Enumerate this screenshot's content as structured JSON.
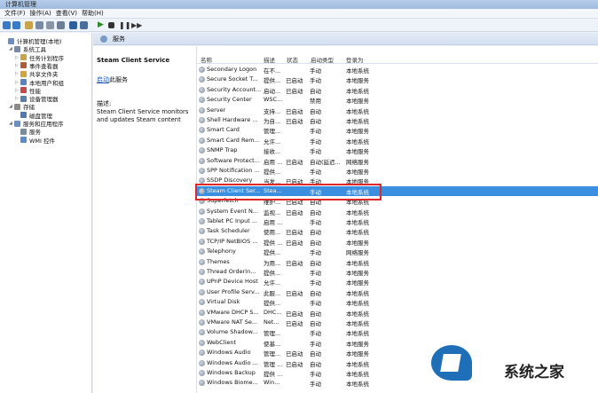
{
  "window": {
    "title": "计算机管理"
  },
  "menu": [
    "文件(F)",
    "操作(A)",
    "查看(V)",
    "帮助(H)"
  ],
  "tree": [
    {
      "label": "计算机管理(本地)",
      "level": 0
    },
    {
      "label": "系统工具",
      "level": 1
    },
    {
      "label": "任务计划程序",
      "level": 2
    },
    {
      "label": "事件查看器",
      "level": 2
    },
    {
      "label": "共享文件夹",
      "level": 2
    },
    {
      "label": "本地用户和组",
      "level": 2
    },
    {
      "label": "性能",
      "level": 2
    },
    {
      "label": "设备管理器",
      "level": 2
    },
    {
      "label": "存储",
      "level": 1
    },
    {
      "label": "磁盘管理",
      "level": 2
    },
    {
      "label": "服务和应用程序",
      "level": 1
    },
    {
      "label": "服务",
      "level": 2
    },
    {
      "label": "WMI 控件",
      "level": 2
    }
  ],
  "header": {
    "title": "服务"
  },
  "details": {
    "service_name": "Steam Client Service",
    "start_link": "启动",
    "start_suffix": "此服务",
    "desc_label": "描述:",
    "desc_text": "Steam Client Service monitors and updates Steam content"
  },
  "columns": [
    "名称",
    "描述",
    "状态",
    "启动类型",
    "登录为"
  ],
  "services": [
    [
      "Secondary Logon",
      "在不...",
      "",
      "手动",
      "本地系统"
    ],
    [
      "Secure Socket T...",
      "提供...",
      "已启动",
      "手动",
      "本地服务"
    ],
    [
      "Security Account...",
      "启动...",
      "已启动",
      "自动",
      "本地系统"
    ],
    [
      "Security Center",
      "WSC...",
      "",
      "禁用",
      "本地服务"
    ],
    [
      "Server",
      "支持...",
      "已启动",
      "自动",
      "本地系统"
    ],
    [
      "Shell Hardware ...",
      "为自...",
      "已启动",
      "自动",
      "本地系统"
    ],
    [
      "Smart Card",
      "管理...",
      "",
      "手动",
      "本地服务"
    ],
    [
      "Smart Card Rem...",
      "允许...",
      "",
      "手动",
      "本地系统"
    ],
    [
      "SNMP Trap",
      "接收...",
      "",
      "手动",
      "本地服务"
    ],
    [
      "Software Protect...",
      "启用 ...",
      "已启动",
      "自动(延迟...",
      "网络服务"
    ],
    [
      "SPP Notification ...",
      "提供...",
      "",
      "手动",
      "本地服务"
    ],
    [
      "SSDP Discovery",
      "当发...",
      "已启动",
      "手动",
      "本地服务"
    ],
    [
      "Steam Client Ser...",
      "Stea...",
      "",
      "手动",
      "本地系统"
    ],
    [
      "Superfetch",
      "维护...",
      "已启动",
      "自动",
      "本地系统"
    ],
    [
      "System Event N...",
      "监视...",
      "已启动",
      "自动",
      "本地系统"
    ],
    [
      "Tablet PC Input ...",
      "启用 ...",
      "",
      "手动",
      "本地系统"
    ],
    [
      "Task Scheduler",
      "使用...",
      "已启动",
      "自动",
      "本地系统"
    ],
    [
      "TCP/IP NetBIOS ...",
      "提供 ...",
      "已启动",
      "自动",
      "本地服务"
    ],
    [
      "Telephony",
      "提供...",
      "",
      "手动",
      "网络服务"
    ],
    [
      "Themes",
      "为用...",
      "已启动",
      "自动",
      "本地系统"
    ],
    [
      "Thread Orderin...",
      "提供...",
      "",
      "手动",
      "本地服务"
    ],
    [
      "UPnP Device Host",
      "允许...",
      "",
      "手动",
      "本地服务"
    ],
    [
      "User Profile Serv...",
      "此服...",
      "已启动",
      "自动",
      "本地系统"
    ],
    [
      "Virtual Disk",
      "提供...",
      "",
      "手动",
      "本地系统"
    ],
    [
      "VMware DHCP S...",
      "DHC...",
      "已启动",
      "自动",
      "本地系统"
    ],
    [
      "VMware NAT Se...",
      "Net...",
      "已启动",
      "自动",
      "本地系统"
    ],
    [
      "Volume Shadow...",
      "管理...",
      "",
      "手动",
      "本地系统"
    ],
    [
      "WebClient",
      "使基...",
      "",
      "手动",
      "本地服务"
    ],
    [
      "Windows Audio",
      "管理...",
      "已启动",
      "自动",
      "本地服务"
    ],
    [
      "Windows Audio ...",
      "管理 ...",
      "已启动",
      "自动",
      "本地系统"
    ],
    [
      "Windows Backup",
      "提供 ...",
      "",
      "手动",
      "本地系统"
    ],
    [
      "Windows Biome...",
      "Win...",
      "",
      "手动",
      "本地系统"
    ]
  ],
  "selected_index": 12,
  "watermark": {
    "text": "系统之家"
  }
}
